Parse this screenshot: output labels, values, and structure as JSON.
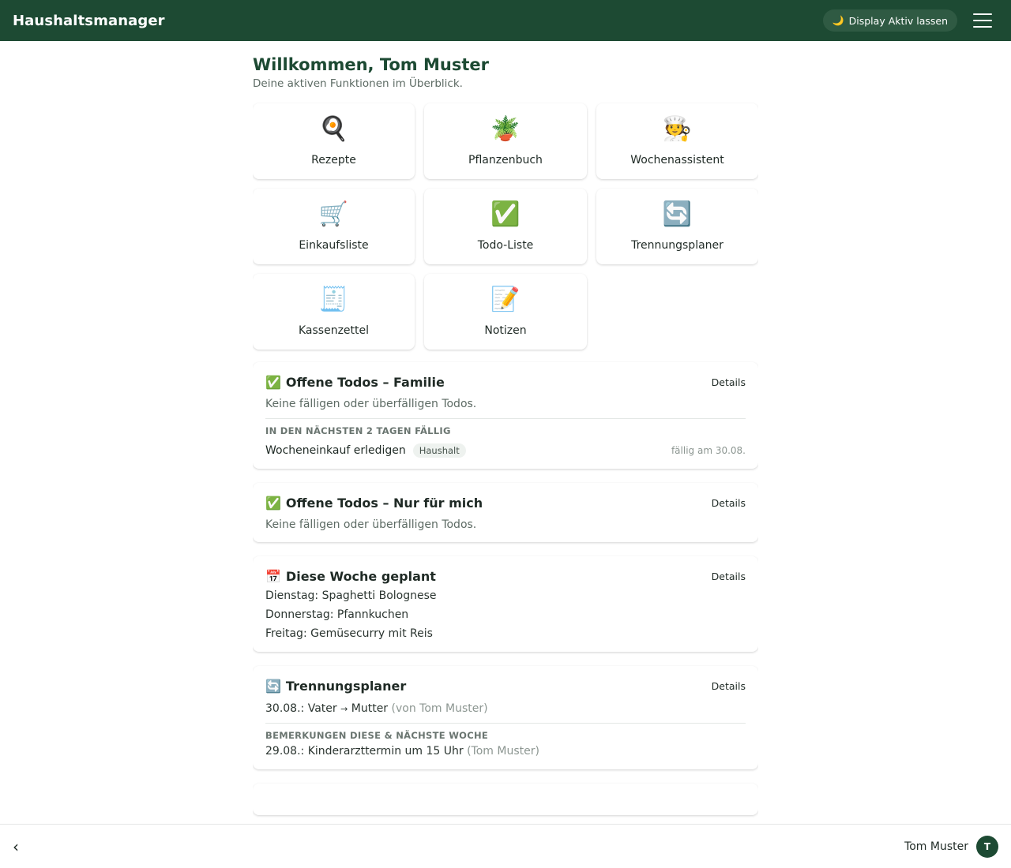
{
  "header": {
    "title": "Haushaltsmanager",
    "display_button": "Display Aktiv lassen",
    "display_icon": "🌙",
    "menu_icon": "hamburger-icon"
  },
  "welcome": {
    "title": "Willkommen, Tom Muster",
    "subtitle": "Deine aktiven Funktionen im Überblick."
  },
  "tiles": [
    {
      "icon": "🍳",
      "label": "Rezepte"
    },
    {
      "icon": "🪴",
      "label": "Pflanzenbuch"
    },
    {
      "icon": "🧑‍🍳",
      "label": "Wochenassistent"
    },
    {
      "icon": "🛒",
      "label": "Einkaufsliste"
    },
    {
      "icon": "✅",
      "label": "Todo-Liste"
    },
    {
      "icon": "🔄",
      "label": "Trennungsplaner"
    },
    {
      "icon": "🧾",
      "label": "Kassenzettel"
    },
    {
      "icon": "📝",
      "label": "Notizen"
    }
  ],
  "cards": {
    "todos_family": {
      "icon": "✅",
      "title": "Offene Todos – Familie",
      "details": "Details",
      "empty": "Keine fälligen oder überfälligen Todos.",
      "section": "IN DEN NÄCHSTEN 2 TAGEN FÄLLIG",
      "item": {
        "text": "Wocheneinkauf erledigen",
        "tag": "Haushalt",
        "due": "fällig am 30.08."
      }
    },
    "todos_me": {
      "icon": "✅",
      "title": "Offene Todos – Nur für mich",
      "details": "Details",
      "empty": "Keine fälligen oder überfälligen Todos."
    },
    "week": {
      "icon": "📅",
      "title": "Diese Woche geplant",
      "details": "Details",
      "lines": [
        "Dienstag: Spaghetti Bolognese",
        "Donnerstag: Pfannkuchen",
        "Freitag: Gemüsecurry mit Reis"
      ]
    },
    "trennung": {
      "icon": "🔄",
      "title": "Trennungsplaner",
      "details": "Details",
      "handover": {
        "date": "30.08.:",
        "from": "Vater",
        "arrow": "→",
        "to": "Mutter",
        "by": "(von Tom Muster)"
      },
      "section": "BEMERKUNGEN DIESE & NÄCHSTE WOCHE",
      "note": {
        "text": "29.08.: Kinderarzttermin um 15 Uhr",
        "by": "(Tom Muster)"
      }
    }
  },
  "footer": {
    "back_icon": "‹",
    "user_name": "Tom Muster",
    "avatar_initial": "T"
  }
}
